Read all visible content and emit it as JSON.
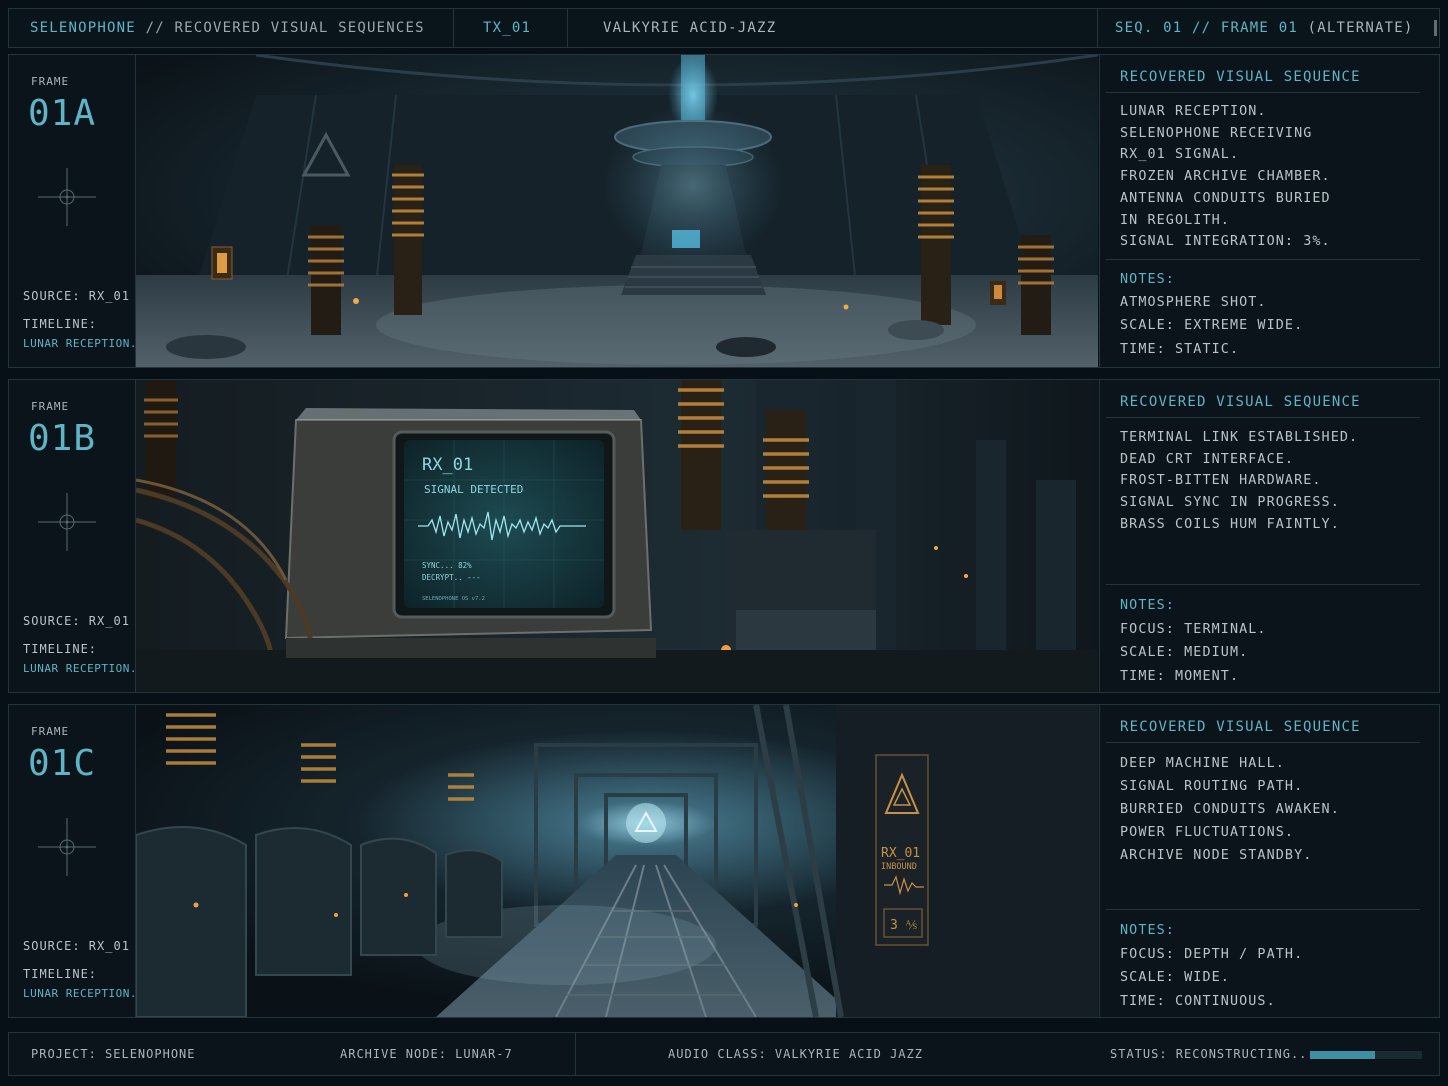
{
  "header": {
    "project": "SELENOPHONE",
    "subtitle": "// RECOVERED VISUAL SEQUENCES",
    "tx": "TX_01",
    "track": "VALKYRIE ACID-JAZZ",
    "seq": "SEQ. 01 // FRAME 01",
    "seq_suffix": "(ALTERNATE)"
  },
  "frames": [
    {
      "label": "FRAME",
      "id": "01A",
      "source": "SOURCE: RX_01",
      "timeline_label": "TIMELINE:",
      "timeline_value": "LUNAR RECEPTION.",
      "title": "RECOVERED VISUAL SEQUENCE",
      "description": [
        "LUNAR RECEPTION.",
        "SELENOPHONE RECEIVING",
        "RX_01 SIGNAL.",
        "FROZEN ARCHIVE CHAMBER.",
        "ANTENNA CONDUITS BURIED",
        "IN REGOLITH.",
        "SIGNAL INTEGRATION: 3%."
      ],
      "notes_title": "NOTES:",
      "notes": [
        "ATMOSPHERE SHOT.",
        "SCALE: EXTREME WIDE.",
        "TIME: STATIC."
      ]
    },
    {
      "label": "FRAME",
      "id": "01B",
      "source": "SOURCE: RX_01",
      "timeline_label": "TIMELINE:",
      "timeline_value": "LUNAR RECEPTION.",
      "title": "RECOVERED VISUAL SEQUENCE",
      "description": [
        "TERMINAL LINK ESTABLISHED.",
        "DEAD CRT INTERFACE.",
        "FROST-BITTEN HARDWARE.",
        "SIGNAL SYNC IN PROGRESS.",
        "BRASS COILS HUM FAINTLY."
      ],
      "notes_title": "NOTES:",
      "notes": [
        "FOCUS: TERMINAL.",
        "SCALE: MEDIUM.",
        "TIME: MOMENT."
      ],
      "screen": {
        "title": "RX_01",
        "subtitle": "SIGNAL DETECTED",
        "sync": "SYNC... 82%",
        "decrypt": "DECRYPT.. ---",
        "os": "SELENOPHONE OS v7.2"
      }
    },
    {
      "label": "FRAME",
      "id": "01C",
      "source": "SOURCE: RX_01",
      "timeline_label": "TIMELINE:",
      "timeline_value": "LUNAR RECEPTION.",
      "title": "RECOVERED VISUAL SEQUENCE",
      "description": [
        "DEEP MACHINE HALL.",
        "SIGNAL ROUTING PATH.",
        "BURRIED CONDUITS AWAKEN.",
        "POWER FLUCTUATIONS.",
        "ARCHIVE NODE STANDBY."
      ],
      "notes_title": "NOTES:",
      "notes": [
        "FOCUS: DEPTH / PATH.",
        "SCALE: WIDE.",
        "TIME: CONTINUOUS."
      ],
      "panel": {
        "line1": "RX_01",
        "line2": "INBOUND",
        "line3": "3 ⅍"
      }
    }
  ],
  "footer": {
    "project": "PROJECT: SELENOPHONE",
    "node": "ARCHIVE NODE: LUNAR-7",
    "audio": "AUDIO CLASS: VALKYRIE ACID JAZZ",
    "status": "STATUS: RECONSTRUCTING...",
    "progress": 0.58
  },
  "colors": {
    "accent": "#5fb4c6",
    "background": "#071016",
    "border": "#24343b",
    "brass": "#c08a3e"
  }
}
